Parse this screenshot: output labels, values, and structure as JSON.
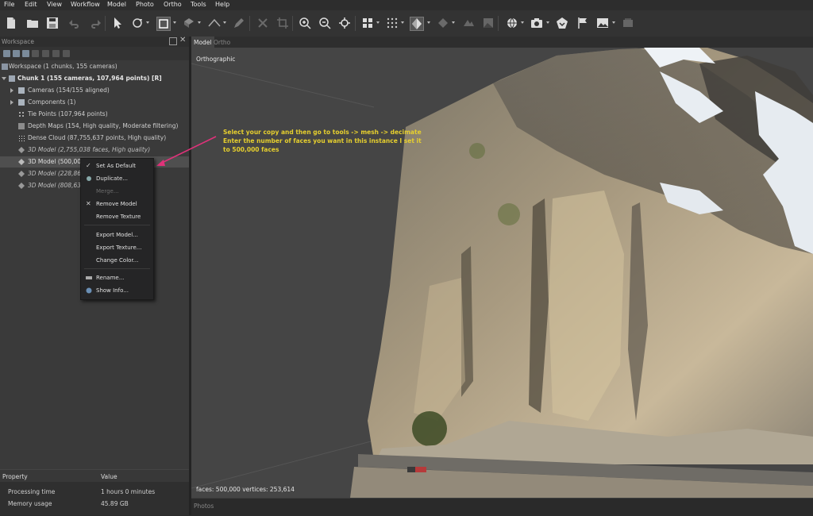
{
  "menu": [
    "File",
    "Edit",
    "View",
    "Workflow",
    "Model",
    "Photo",
    "Ortho",
    "Tools",
    "Help"
  ],
  "workspace": {
    "title": "Workspace",
    "items": [
      "Workspace (1 chunks, 155 cameras)",
      "Chunk 1 (155 cameras, 107,964 points) [R]",
      "Cameras (154/155 aligned)",
      "Components (1)",
      "Tie Points (107,964 points)",
      "Depth Maps (154, High quality, Moderate filtering)",
      "Dense Cloud (87,755,637 points, High quality)",
      "3D Model (2,755,038 faces, High quality)",
      "3D Model (500,000 f",
      "3D Model (228,866 fa",
      "3D Model (808,639 fa"
    ]
  },
  "context_menu": {
    "items": [
      "Set As Default",
      "Duplicate...",
      "Merge...",
      "Remove Model",
      "Remove Texture",
      "Export Model...",
      "Export Texture...",
      "Change Color...",
      "Rename...",
      "Show Info..."
    ]
  },
  "properties": {
    "headers": [
      "Property",
      "Value"
    ],
    "rows": [
      [
        "Processing time",
        "1 hours 0 minutes"
      ],
      [
        "Memory usage",
        "45.89 GB"
      ]
    ]
  },
  "tabs": [
    "Model",
    "Ortho"
  ],
  "viewport": {
    "projection": "Orthographic",
    "status": "faces: 500,000 vertices: 253,614"
  },
  "annotation": {
    "lines": [
      "Select your copy and then go to tools -> mesh -> decimate",
      "Enter the number of faces you want in this instance I set it",
      "to 500,000 faces"
    ],
    "color": "#e6cf2e"
  },
  "bottom_panel": "Photos",
  "colors": {
    "arrow": "#e0327a",
    "highlight_row": "#4f4f4f"
  }
}
